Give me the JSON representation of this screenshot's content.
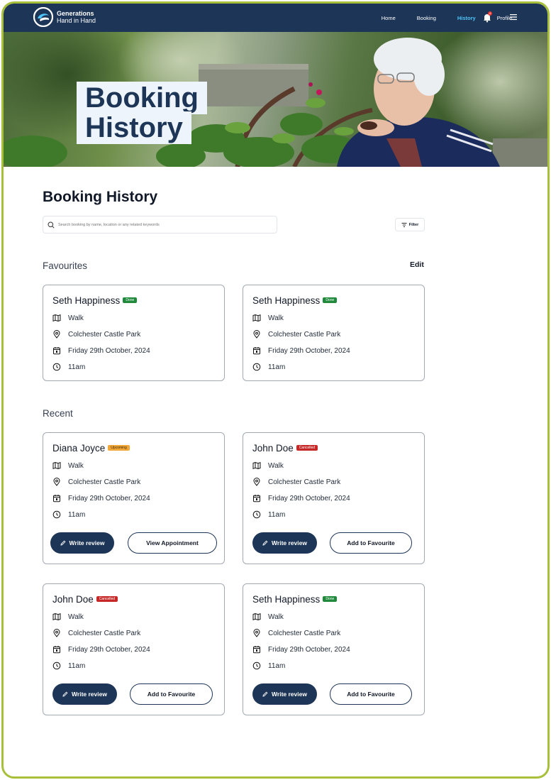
{
  "brand": {
    "line1": "Generations",
    "line2": "Hand in Hand"
  },
  "nav": {
    "links": [
      "Home",
      "Booking",
      "History",
      "Profile"
    ],
    "active": "History",
    "notification_count": "4"
  },
  "hero": {
    "title_line1": "Booking",
    "title_line2": "History"
  },
  "main": {
    "title": "Booking History",
    "search_placeholder": "Search booking by name, location or any related keywords",
    "filter_label": "Filter"
  },
  "favourites": {
    "title": "Favourites",
    "edit_label": "Edit",
    "cards": [
      {
        "name": "Seth Happiness",
        "status": "Done",
        "activity": "Walk",
        "location": "Colchester Castle Park",
        "date": "Friday 29th October, 2024",
        "time": "11am"
      },
      {
        "name": "Seth Happiness",
        "status": "Done",
        "activity": "Walk",
        "location": "Colchester Castle Park",
        "date": "Friday 29th October, 2024",
        "time": "11am"
      }
    ]
  },
  "recent": {
    "title": "Recent",
    "cards": [
      {
        "name": "Diana Joyce",
        "status": "Upcoming",
        "activity": "Walk",
        "location": "Colchester Castle Park",
        "date": "Friday 29th October, 2024",
        "time": "11am",
        "primary": "Write review",
        "secondary": "View Appointment"
      },
      {
        "name": "John Doe",
        "status": "Cancelled",
        "activity": "Walk",
        "location": "Colchester Castle Park",
        "date": "Friday 29th October, 2024",
        "time": "11am",
        "primary": "Write review",
        "secondary": "Add to Favourite"
      },
      {
        "name": "John Doe",
        "status": "Cancelled",
        "activity": "Walk",
        "location": "Colchester Castle Park",
        "date": "Friday 29th October, 2024",
        "time": "11am",
        "primary": "Write review",
        "secondary": "Add to Favourite"
      },
      {
        "name": "Seth Happiness",
        "status": "Done",
        "activity": "Walk",
        "location": "Colchester Castle Park",
        "date": "Friday 29th October, 2024",
        "time": "11am",
        "primary": "Write review",
        "secondary": "Add to Favourite"
      }
    ]
  },
  "icons": {
    "activity": "map-icon",
    "location": "location-pin-icon",
    "date": "calendar-icon",
    "time": "clock-icon",
    "review": "pencil-icon"
  },
  "colors": {
    "navy": "#1d3557",
    "accent": "#4fc3f7",
    "frame": "#a8bf3a",
    "done": "#1f8a3b",
    "upcoming": "#f2a73b",
    "cancelled": "#c62828"
  }
}
